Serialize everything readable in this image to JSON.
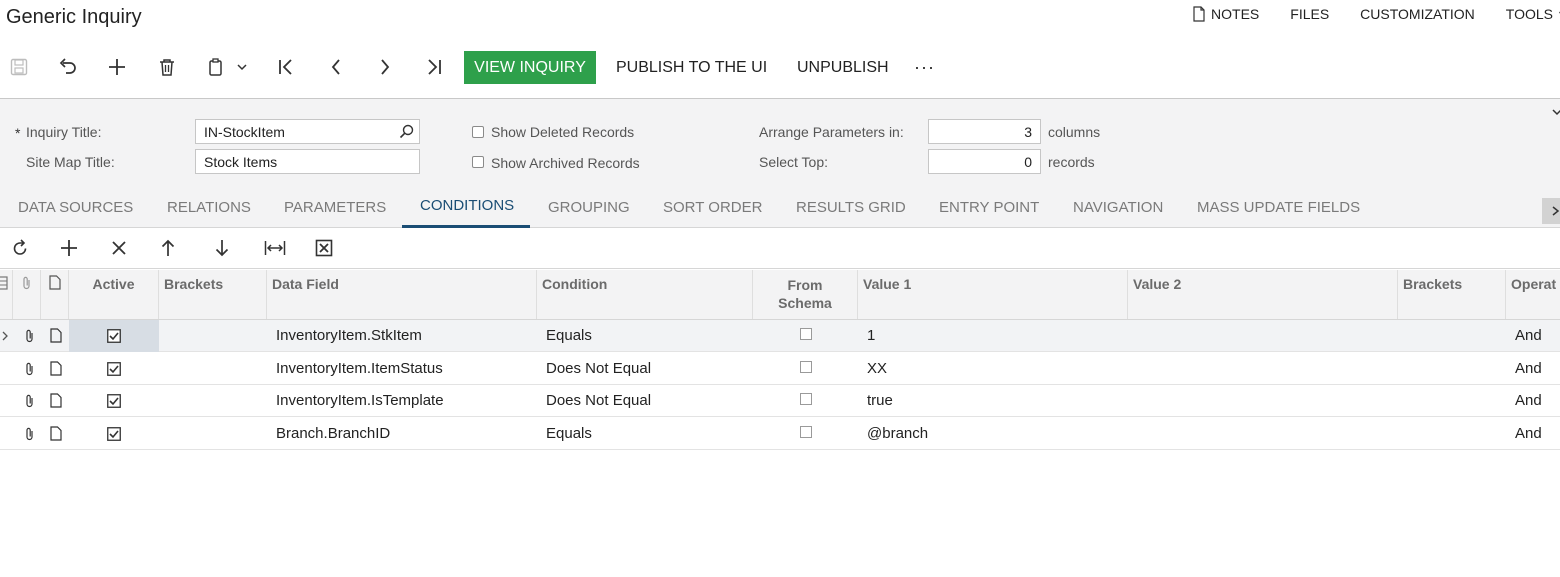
{
  "page": {
    "title": "Generic Inquiry"
  },
  "top_links": {
    "notes": "NOTES",
    "files": "FILES",
    "customization": "CUSTOMIZATION",
    "tools": "TOOLS"
  },
  "toolbar": {
    "view_inquiry": "VIEW INQUIRY",
    "publish": "PUBLISH TO THE UI",
    "unpublish": "UNPUBLISH",
    "more": "···"
  },
  "form": {
    "inquiry_title_label": "Inquiry Title:",
    "inquiry_title_value": "IN-StockItem",
    "site_map_title_label": "Site Map Title:",
    "site_map_title_value": "Stock Items",
    "show_deleted_label": "Show Deleted Records",
    "show_archived_label": "Show Archived Records",
    "arrange_params_label": "Arrange Parameters in:",
    "arrange_params_value": "3",
    "arrange_params_unit": "columns",
    "select_top_label": "Select Top:",
    "select_top_value": "0",
    "select_top_unit": "records",
    "show_deleted_checked": false,
    "show_archived_checked": false
  },
  "tabs": [
    {
      "label": "DATA SOURCES"
    },
    {
      "label": "RELATIONS"
    },
    {
      "label": "PARAMETERS"
    },
    {
      "label": "CONDITIONS"
    },
    {
      "label": "GROUPING"
    },
    {
      "label": "SORT ORDER"
    },
    {
      "label": "RESULTS GRID"
    },
    {
      "label": "ENTRY POINT"
    },
    {
      "label": "NAVIGATION"
    },
    {
      "label": "MASS UPDATE FIELDS"
    }
  ],
  "active_tab": "CONDITIONS",
  "grid": {
    "columns": {
      "active": "Active",
      "brackets_open": "Brackets",
      "data_field": "Data Field",
      "condition": "Condition",
      "from_schema_1": "From",
      "from_schema_2": "Schema",
      "value1": "Value 1",
      "value2": "Value 2",
      "brackets_close": "Brackets",
      "operator": "Operat"
    },
    "rows": [
      {
        "active": true,
        "data_field": "InventoryItem.StkItem",
        "condition": "Equals",
        "from_schema": false,
        "value1": "1",
        "value2": "",
        "operator": "And"
      },
      {
        "active": true,
        "data_field": "InventoryItem.ItemStatus",
        "condition": "Does Not Equal",
        "from_schema": false,
        "value1": "XX",
        "value2": "",
        "operator": "And"
      },
      {
        "active": true,
        "data_field": "InventoryItem.IsTemplate",
        "condition": "Does Not Equal",
        "from_schema": false,
        "value1": "true",
        "value2": "",
        "operator": "And"
      },
      {
        "active": true,
        "data_field": "Branch.BranchID",
        "condition": "Equals",
        "from_schema": false,
        "value1": "@branch",
        "value2": "",
        "operator": "And"
      }
    ]
  },
  "colors": {
    "accent_green": "#2ea04b",
    "tab_active": "#1a4d74",
    "panel_bg": "#f3f3f4"
  }
}
